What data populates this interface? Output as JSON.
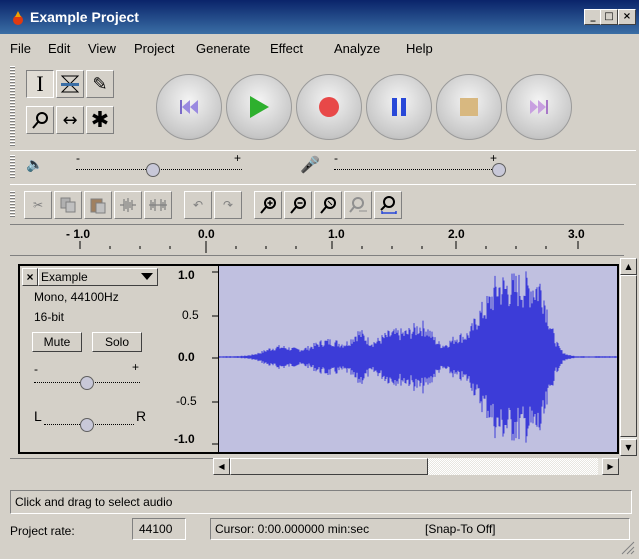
{
  "window": {
    "title": "Example Project",
    "minimize": "_",
    "maximize": "□",
    "close": "×"
  },
  "menu": [
    "File",
    "Edit",
    "View",
    "Project",
    "Generate",
    "Effect",
    "Analyze",
    "Help"
  ],
  "mixer": {
    "minus": "-",
    "plus": "+"
  },
  "ruler": {
    "labels": [
      "- 1.0",
      "0.0",
      "1.0",
      "2.0",
      "3.0"
    ]
  },
  "track": {
    "close": "×",
    "name": "Example",
    "rate": "Mono, 44100Hz",
    "bits": "16-bit",
    "mute": "Mute",
    "solo": "Solo",
    "gain_minus": "-",
    "gain_plus": "+",
    "pan_left": "L",
    "pan_right": "R"
  },
  "scale": [
    "1.0",
    "0.5",
    "0.0",
    "-0.5",
    "-1.0"
  ],
  "status": {
    "hint": "Click and drag to select audio",
    "project_rate_label": "Project rate:",
    "project_rate_value": "44100",
    "cursor": "Cursor: 0:00.000000 min:sec",
    "snap": "[Snap-To Off]"
  },
  "colors": {
    "waveform": "#3c3cd8",
    "title_bar": "#0a246a",
    "wave_bg": "#c0c0e0"
  },
  "icons": {
    "tools": [
      "select-icon",
      "envelope-icon",
      "draw-icon",
      "zoom-icon",
      "timeshift-icon",
      "multi-tool-icon"
    ],
    "transport": [
      "skip-start-icon",
      "play-icon",
      "record-icon",
      "pause-icon",
      "stop-icon",
      "skip-end-icon"
    ],
    "edit": [
      "cut-icon",
      "copy-icon",
      "paste-icon",
      "trim-icon",
      "silence-icon",
      "undo-icon",
      "redo-icon",
      "zoom-in-icon",
      "zoom-out-icon",
      "fit-selection-icon",
      "fit-project-icon",
      "zoom-toggle-icon"
    ]
  }
}
